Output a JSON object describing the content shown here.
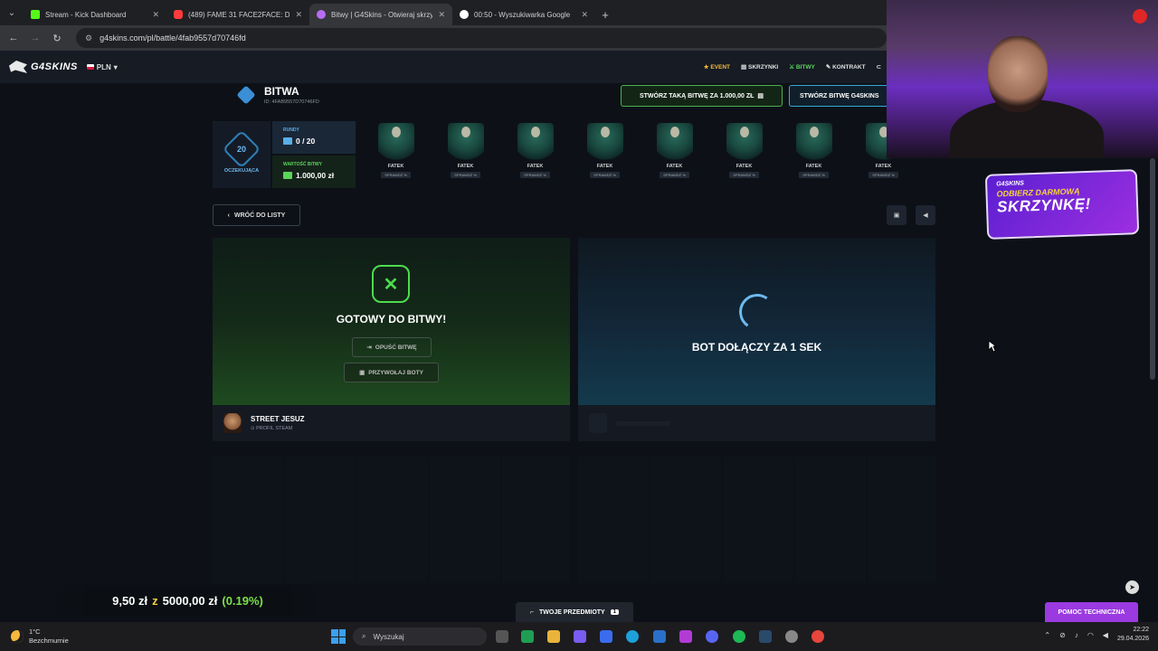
{
  "browser": {
    "tabs": [
      {
        "title": "Stream - Kick Dashboard",
        "color": "#53fc18",
        "active": false
      },
      {
        "title": "(489) FAME 31 FACE2FACE: Don",
        "color": "#ff3b3b",
        "active": false
      },
      {
        "title": "Bitwy | G4Skins - Otwieraj skrzy",
        "color": "#b86cf0",
        "active": true
      },
      {
        "title": "00:50 - Wyszukiwarka Google",
        "color": "#ffffff",
        "active": false
      }
    ],
    "url": "g4skins.com/pl/battle/4fab9557d70746fd"
  },
  "site": {
    "logo": "G4SKINS",
    "currency": "PLN",
    "nav": [
      "EVENT",
      "SKRZYNKI",
      "BITWY",
      "KONTRAKT"
    ]
  },
  "battle": {
    "title": "BITWA",
    "id": "ID: 4FAB9557D70746FD",
    "create_same": "STWÓRZ TAKĄ BITWĘ ZA 1.000,00 ZŁ",
    "create_g4": "STWÓRZ BITWĘ G4SKINS",
    "status_count": "20",
    "status_label": "OCZEKUJĄCA",
    "rounds_label": "RUNDY",
    "rounds_value": "0 / 20",
    "value_label": "WARTOŚĆ BITWY",
    "value_value": "1.000,00 zł",
    "cases": [
      {
        "price": "50,00 zł",
        "name": "FATEK",
        "check": "SPRAWDŹ %"
      },
      {
        "price": "50,00 zł",
        "name": "FATEK",
        "check": "SPRAWDŹ %"
      },
      {
        "price": "50,00 zł",
        "name": "FATEK",
        "check": "SPRAWDŹ %"
      },
      {
        "price": "50,00 zł",
        "name": "FATEK",
        "check": "SPRAWDŹ %"
      },
      {
        "price": "50,00 zł",
        "name": "FATEK",
        "check": "SPRAWDŹ %"
      },
      {
        "price": "50,00 zł",
        "name": "FATEK",
        "check": "SPRAWDŹ %"
      },
      {
        "price": "50,00 zł",
        "name": "FATEK",
        "check": "SPRAWDŹ %"
      },
      {
        "price": "50,00 zł",
        "name": "FATEK",
        "check": "SPRAWDŹ %"
      }
    ],
    "back": "WRÓĆ DO LISTY",
    "ready": "GOTOWY DO BITWY!",
    "leave": "OPUŚĆ BITWĘ",
    "summon": "PRZYWOŁAJ BOTY",
    "bot_join": "BOT DOŁĄCZY ZA 1 SEK",
    "player_name": "STREET JESUZ",
    "player_sub": "PROFIL STEAM"
  },
  "promo": {
    "brand": "G4SKINS",
    "line1": "ODBIERZ DARMOWĄ",
    "line2": "SKRZYNKĘ!"
  },
  "overlay": {
    "bal_now": "9,50 zł",
    "bal_of": "z",
    "bal_goal": "5000,00 zł",
    "bal_pct": "(0.19%)",
    "items": "TWOJE PRZEDMIOTY",
    "items_count": "1",
    "help": "POMOC TECHNICZNA"
  },
  "taskbar": {
    "temp": "1°C",
    "weather": "Bezchmurnie",
    "search": "Wyszukaj",
    "time": "22:22",
    "date": "29.04.2026"
  }
}
